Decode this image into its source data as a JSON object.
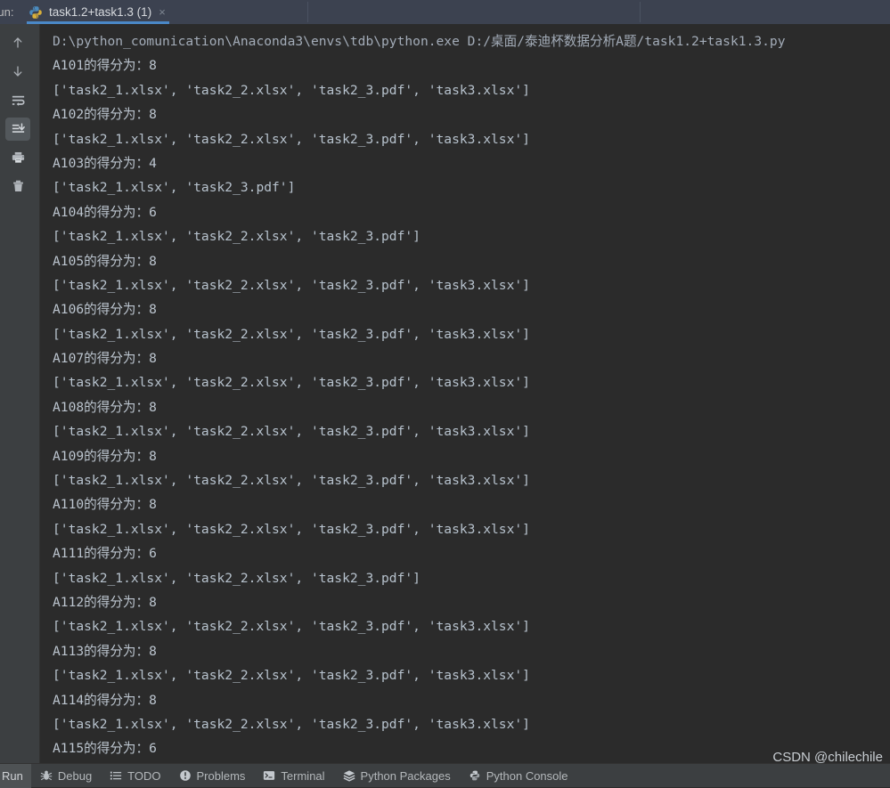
{
  "window": {
    "run_tool_label": "Run:",
    "active_tab": {
      "title": "task1.2+task1.3 (1)",
      "icon": "python-file-icon",
      "close_label": "×"
    }
  },
  "gutter": {
    "buttons": [
      {
        "name": "up-arrow-icon",
        "tooltip": "Previous Occurrence",
        "selected": false
      },
      {
        "name": "down-arrow-icon",
        "tooltip": "Next Occurrence",
        "selected": false
      },
      {
        "name": "soft-wrap-icon",
        "tooltip": "Soft-Wrap",
        "selected": false
      },
      {
        "name": "scroll-to-end-icon",
        "tooltip": "Scroll to End",
        "selected": true
      },
      {
        "name": "print-icon",
        "tooltip": "Print",
        "selected": false
      },
      {
        "name": "trash-icon",
        "tooltip": "Clear All",
        "selected": false
      }
    ]
  },
  "console": {
    "lines": [
      {
        "kind": "cmd",
        "text": "D:\\python_comunication\\Anaconda3\\envs\\tdb\\python.exe D:/桌面/泰迪杯数据分析A题/task1.2+task1.3.py"
      },
      {
        "kind": "score",
        "text": "A101的得分为：8"
      },
      {
        "kind": "list",
        "text": "['task2_1.xlsx', 'task2_2.xlsx', 'task2_3.pdf', 'task3.xlsx']"
      },
      {
        "kind": "score",
        "text": "A102的得分为：8"
      },
      {
        "kind": "list",
        "text": "['task2_1.xlsx', 'task2_2.xlsx', 'task2_3.pdf', 'task3.xlsx']"
      },
      {
        "kind": "score",
        "text": "A103的得分为：4"
      },
      {
        "kind": "list",
        "text": "['task2_1.xlsx', 'task2_3.pdf']"
      },
      {
        "kind": "score",
        "text": "A104的得分为：6"
      },
      {
        "kind": "list",
        "text": "['task2_1.xlsx', 'task2_2.xlsx', 'task2_3.pdf']"
      },
      {
        "kind": "score",
        "text": "A105的得分为：8"
      },
      {
        "kind": "list",
        "text": "['task2_1.xlsx', 'task2_2.xlsx', 'task2_3.pdf', 'task3.xlsx']"
      },
      {
        "kind": "score",
        "text": "A106的得分为：8"
      },
      {
        "kind": "list",
        "text": "['task2_1.xlsx', 'task2_2.xlsx', 'task2_3.pdf', 'task3.xlsx']"
      },
      {
        "kind": "score",
        "text": "A107的得分为：8"
      },
      {
        "kind": "list",
        "text": "['task2_1.xlsx', 'task2_2.xlsx', 'task2_3.pdf', 'task3.xlsx']"
      },
      {
        "kind": "score",
        "text": "A108的得分为：8"
      },
      {
        "kind": "list",
        "text": "['task2_1.xlsx', 'task2_2.xlsx', 'task2_3.pdf', 'task3.xlsx']"
      },
      {
        "kind": "score",
        "text": "A109的得分为：8"
      },
      {
        "kind": "list",
        "text": "['task2_1.xlsx', 'task2_2.xlsx', 'task2_3.pdf', 'task3.xlsx']"
      },
      {
        "kind": "score",
        "text": "A110的得分为：8"
      },
      {
        "kind": "list",
        "text": "['task2_1.xlsx', 'task2_2.xlsx', 'task2_3.pdf', 'task3.xlsx']"
      },
      {
        "kind": "score",
        "text": "A111的得分为：6"
      },
      {
        "kind": "list",
        "text": "['task2_1.xlsx', 'task2_2.xlsx', 'task2_3.pdf']"
      },
      {
        "kind": "score",
        "text": "A112的得分为：8"
      },
      {
        "kind": "list",
        "text": "['task2_1.xlsx', 'task2_2.xlsx', 'task2_3.pdf', 'task3.xlsx']"
      },
      {
        "kind": "score",
        "text": "A113的得分为：8"
      },
      {
        "kind": "list",
        "text": "['task2_1.xlsx', 'task2_2.xlsx', 'task2_3.pdf', 'task3.xlsx']"
      },
      {
        "kind": "score",
        "text": "A114的得分为：8"
      },
      {
        "kind": "list",
        "text": "['task2_1.xlsx', 'task2_2.xlsx', 'task2_3.pdf', 'task3.xlsx']"
      },
      {
        "kind": "score",
        "text": "A115的得分为：6"
      }
    ]
  },
  "statusbar": {
    "active": "Run",
    "items": [
      {
        "label": "Run",
        "icon": "run-icon",
        "active": true
      },
      {
        "label": "Debug",
        "icon": "bug-icon",
        "active": false
      },
      {
        "label": "TODO",
        "icon": "todo-list-icon",
        "active": false
      },
      {
        "label": "Problems",
        "icon": "warning-circle-icon",
        "active": false
      },
      {
        "label": "Terminal",
        "icon": "terminal-icon",
        "active": false
      },
      {
        "label": "Python Packages",
        "icon": "packages-icon",
        "active": false
      },
      {
        "label": "Python Console",
        "icon": "python-icon",
        "active": false
      }
    ]
  },
  "watermark": {
    "text": "CSDN @chilechile"
  },
  "colors": {
    "console_bg": "#2b2b2b",
    "tabbar_bg": "#3c4250",
    "chrome_bg": "#3c3f41",
    "tab_underline": "#4a88c7",
    "console_text": "#b7c2cd",
    "python_blue": "#4b8bbe",
    "python_yellow": "#d9b03a"
  }
}
